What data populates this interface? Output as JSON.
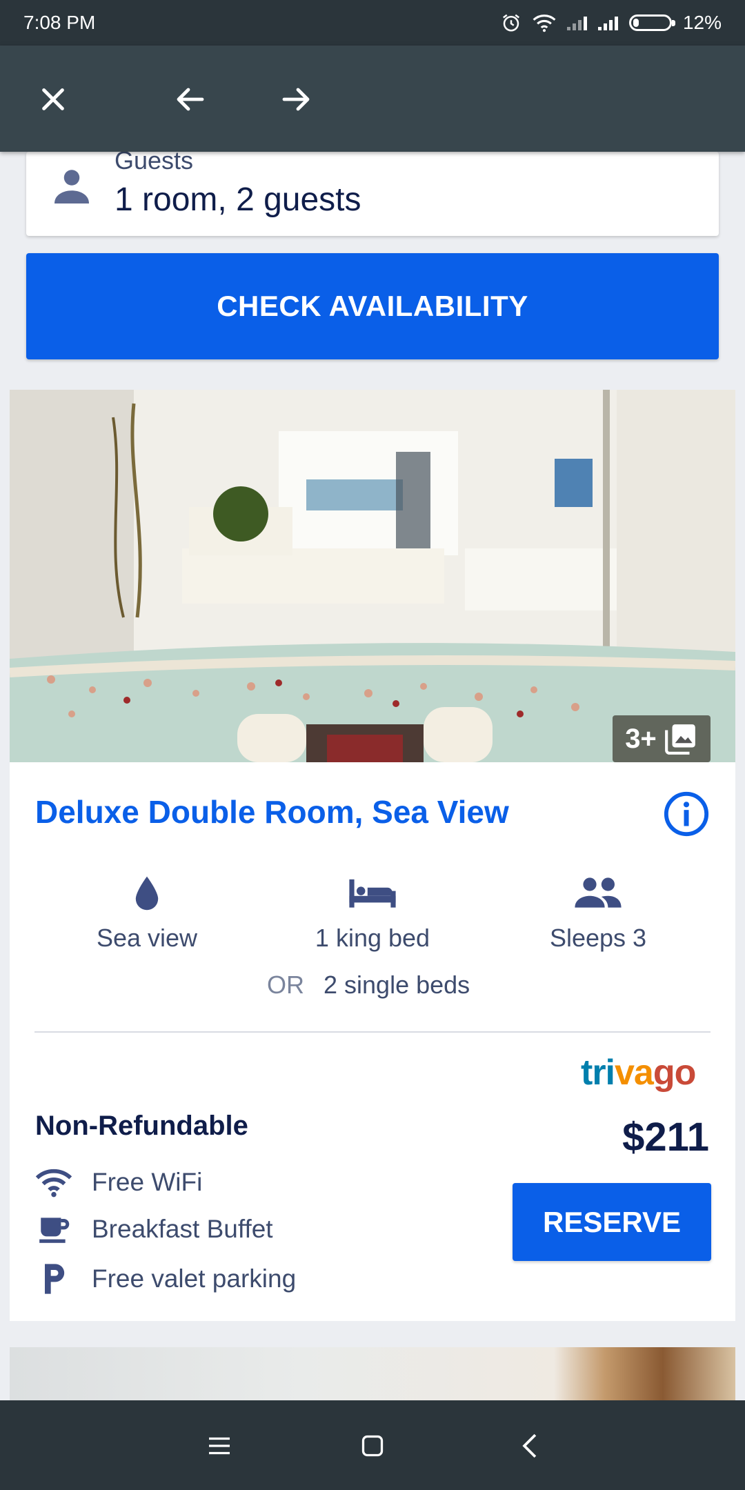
{
  "status_bar": {
    "time": "7:08 PM",
    "battery": "12%"
  },
  "guests": {
    "label": "Guests",
    "value": "1 room, 2 guests"
  },
  "check_button": "CHECK AVAILABILITY",
  "room": {
    "photo_count": "3+",
    "title": "Deluxe Double Room, Sea View",
    "amenities": [
      {
        "icon": "water-drop-icon",
        "label": "Sea view"
      },
      {
        "icon": "bed-icon",
        "label": "1 king bed"
      },
      {
        "icon": "people-icon",
        "label": "Sleeps 3"
      }
    ],
    "alt_bed": {
      "or": "OR",
      "label": "2 single beds"
    },
    "provider": {
      "part1": "tri",
      "part2": "va",
      "part3": "go"
    },
    "policy": "Non-Refundable",
    "price": "$211",
    "features": [
      {
        "icon": "wifi-icon",
        "label": "Free WiFi"
      },
      {
        "icon": "coffee-cup-icon",
        "label": "Breakfast Buffet"
      },
      {
        "icon": "parking-icon",
        "label": "Free valet parking"
      }
    ],
    "reserve_button": "RESERVE"
  },
  "colors": {
    "primary": "#0a5fe8",
    "toolbar": "#38464d",
    "status_bar": "#2b353b",
    "text_dark": "#0f1d4a"
  }
}
